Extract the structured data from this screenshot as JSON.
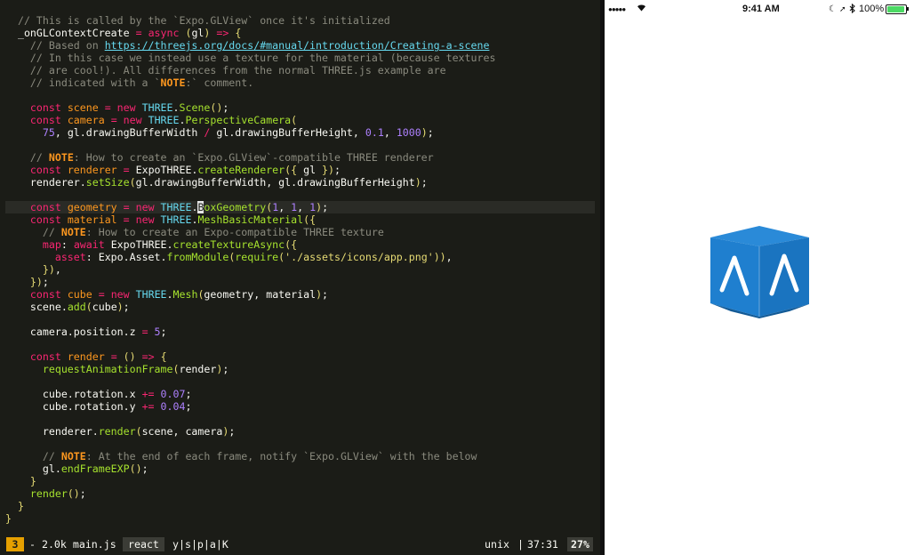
{
  "editor": {
    "lines": [
      "  // This is called by the `Expo.GLView` once it's initialized",
      "  _onGLContextCreate = async (gl) => {",
      "    // Based on https://threejs.org/docs/#manual/introduction/Creating-a-scene",
      "    // In this case we instead use a texture for the material (because textures",
      "    // are cool!). All differences from the normal THREE.js example are",
      "    // indicated with a `NOTE:` comment.",
      "",
      "    const scene = new THREE.Scene();",
      "    const camera = new THREE.PerspectiveCamera(",
      "      75, gl.drawingBufferWidth / gl.drawingBufferHeight, 0.1, 1000);",
      "",
      "    // NOTE: How to create an `Expo.GLView`-compatible THREE renderer",
      "    const renderer = ExpoTHREE.createRenderer({ gl });",
      "    renderer.setSize(gl.drawingBufferWidth, gl.drawingBufferHeight);",
      "",
      "    const geometry = new THREE.BoxGeometry(1, 1, 1);",
      "    const material = new THREE.MeshBasicMaterial({",
      "      // NOTE: How to create an Expo-compatible THREE texture",
      "      map: await ExpoTHREE.createTextureAsync({",
      "        asset: Expo.Asset.fromModule(require('./assets/icons/app.png')),",
      "      }),",
      "    });",
      "    const cube = new THREE.Mesh(geometry, material);",
      "    scene.add(cube);",
      "",
      "    camera.position.z = 5;",
      "",
      "    const render = () => {",
      "      requestAnimationFrame(render);",
      "",
      "      cube.rotation.x += 0.07;",
      "      cube.rotation.y += 0.04;",
      "",
      "      renderer.render(scene, camera);",
      "",
      "      // NOTE: At the end of each frame, notify `Expo.GLView` with the below",
      "      gl.endFrameEXP();",
      "    }",
      "    render();",
      "  }",
      "}"
    ],
    "cursor_line": 16
  },
  "status": {
    "mode_number": "3",
    "file_info": "- 2.0k main.js",
    "filetype": "react",
    "flags": "y|s|p|a|K",
    "encoding": "unix",
    "position": "37:31",
    "percent": "27%"
  },
  "phone": {
    "carrier_signal": "●●●●●",
    "time": "9:41 AM",
    "battery_percent": "100%"
  },
  "colors": {
    "editor_bg": "#1b1c17",
    "keyword": "#f92672",
    "function": "#66d9ef",
    "string": "#e6db74",
    "comment": "#8a8a7e",
    "cube_blue": "#1f7fcf"
  }
}
